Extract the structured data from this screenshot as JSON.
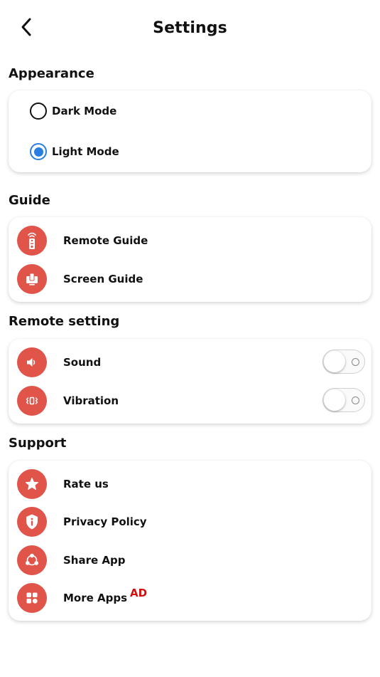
{
  "header": {
    "title": "Settings",
    "back_icon": "chevron-left-icon"
  },
  "appearance": {
    "title": "Appearance",
    "options": [
      {
        "label": "Dark Mode",
        "selected": false
      },
      {
        "label": "Light Mode",
        "selected": true
      }
    ],
    "accent_color": "#2a7de1"
  },
  "guide": {
    "title": "Guide",
    "items": [
      {
        "label": "Remote Guide",
        "icon": "remote-icon"
      },
      {
        "label": "Screen Guide",
        "icon": "screen-icon"
      }
    ]
  },
  "remote_setting": {
    "title": "Remote setting",
    "items": [
      {
        "label": "Sound",
        "icon": "speaker-icon",
        "enabled": false
      },
      {
        "label": "Vibration",
        "icon": "vibration-icon",
        "enabled": false
      }
    ]
  },
  "support": {
    "title": "Support",
    "items": [
      {
        "label": "Rate us",
        "icon": "star-icon"
      },
      {
        "label": "Privacy Policy",
        "icon": "shield-info-icon"
      },
      {
        "label": "Share App",
        "icon": "share-icon"
      },
      {
        "label": "More Apps",
        "icon": "apps-grid-icon",
        "badge": "AD"
      }
    ]
  },
  "colors": {
    "icon_bg": "#e0544a",
    "ad_badge": "#d10f0f"
  }
}
